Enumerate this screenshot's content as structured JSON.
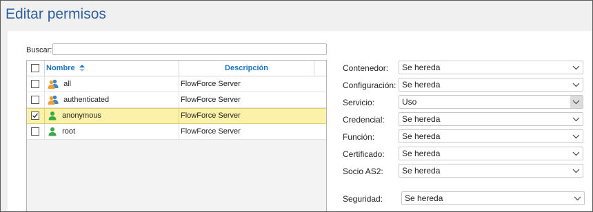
{
  "title": "Editar permisos",
  "search": {
    "label": "Buscar:",
    "value": ""
  },
  "table": {
    "headers": {
      "name": "Nombre",
      "description": "Descripción"
    },
    "rows": [
      {
        "name": "all",
        "description": "FlowForce Server",
        "icon": "user-group-icon",
        "checked": false,
        "selected": false
      },
      {
        "name": "authenticated",
        "description": "FlowForce Server",
        "icon": "user-group-icon",
        "checked": false,
        "selected": false
      },
      {
        "name": "anonymous",
        "description": "FlowForce Server",
        "icon": "user-icon",
        "checked": true,
        "selected": true
      },
      {
        "name": "root",
        "description": "FlowForce Server",
        "icon": "user-icon",
        "checked": false,
        "selected": false
      }
    ]
  },
  "permissions": [
    {
      "label": "Contenedor:",
      "value": "Se hereda"
    },
    {
      "label": "Configuración:",
      "value": "Se hereda"
    },
    {
      "label": "Servicio:",
      "value": "Uso"
    },
    {
      "label": "Credencial:",
      "value": "Se hereda"
    },
    {
      "label": "Función:",
      "value": "Se hereda"
    },
    {
      "label": "Certificado:",
      "value": "Se hereda"
    },
    {
      "label": "Socio AS2:",
      "value": "Se hereda"
    },
    {
      "label": "Seguridad:",
      "value": "Se hereda"
    }
  ],
  "colors": {
    "title": "#2c5f9e",
    "header_link": "#1e73be",
    "selected_row": "#fbf1a9"
  }
}
